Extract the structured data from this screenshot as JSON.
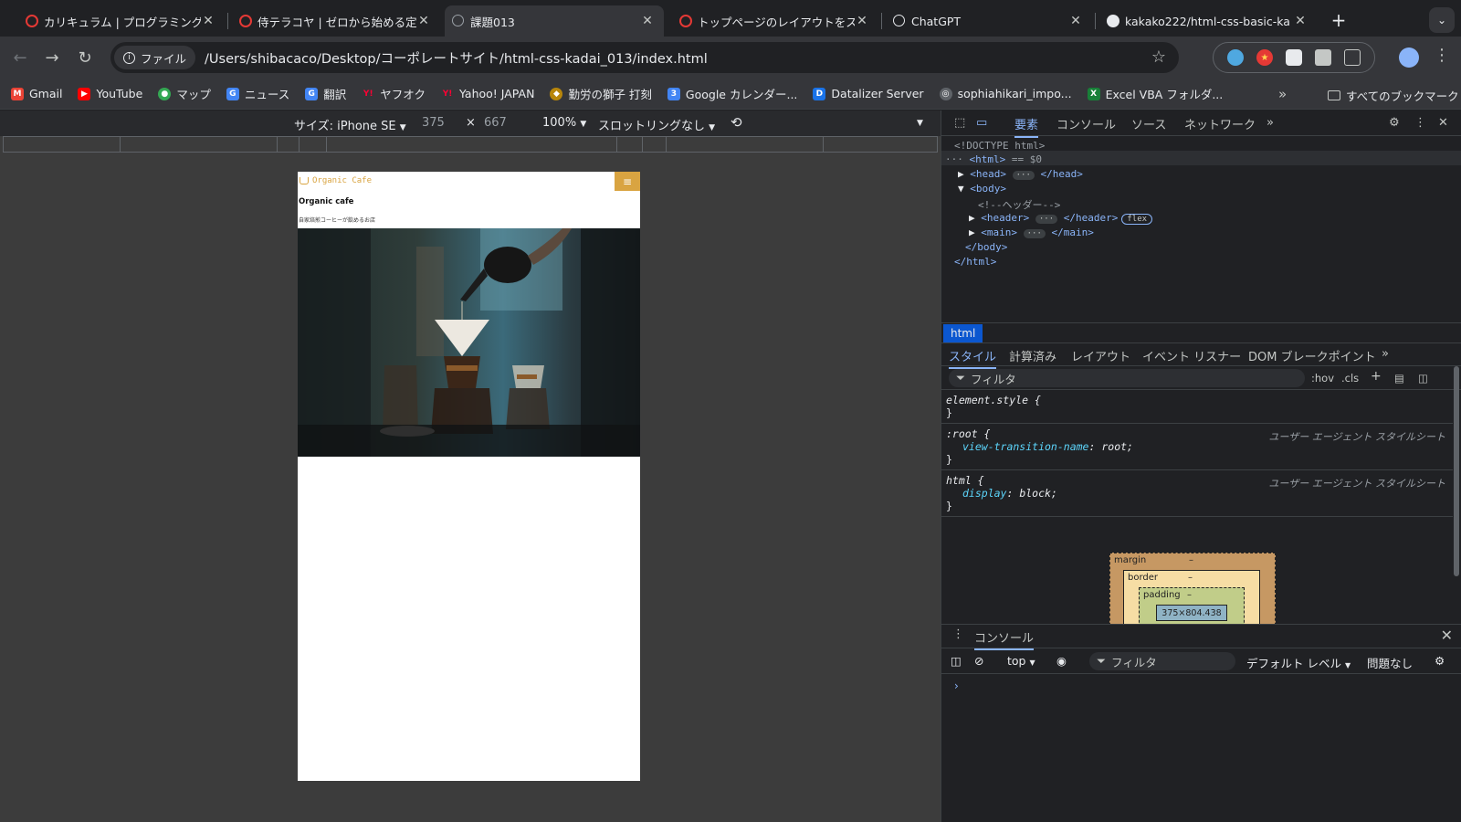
{
  "tabs": [
    {
      "title": "カリキュラム | プログラミング学",
      "icon": "samurai-logo-icon",
      "color": "#e53935",
      "active": false
    },
    {
      "title": "侍テラコヤ | ゼロから始める定額",
      "icon": "samurai-logo-icon",
      "color": "#e53935",
      "active": false
    },
    {
      "title": "課題013",
      "icon": "globe-icon",
      "color": "#9aa0a6",
      "active": true
    },
    {
      "title": "トップページのレイアウトをスマ",
      "icon": "samurai-logo-icon",
      "color": "#e53935",
      "active": false
    },
    {
      "title": "ChatGPT",
      "icon": "chatgpt-icon",
      "color": "#e8eaed",
      "active": false
    },
    {
      "title": "kakako222/html-css-basic-ka",
      "icon": "github-icon",
      "color": "#e8eaed",
      "active": false
    }
  ],
  "address": {
    "info_label": "ファイル",
    "url": "/Users/shibacaco/Desktop/コーポレートサイト/html-css-kadai_013/index.html"
  },
  "bookmarks": [
    {
      "label": "Gmail",
      "color": "#ea4335",
      "glyph": "M"
    },
    {
      "label": "YouTube",
      "color": "#ff0000",
      "glyph": "▶"
    },
    {
      "label": "マップ",
      "color": "#34a853",
      "glyph": "●"
    },
    {
      "label": "ニュース",
      "color": "#4285f4",
      "glyph": "G"
    },
    {
      "label": "翻訳",
      "color": "#4285f4",
      "glyph": "G"
    },
    {
      "label": "ヤフオク",
      "color": "#ff0033",
      "glyph": "Y"
    },
    {
      "label": "Yahoo! JAPAN",
      "color": "#ff0033",
      "glyph": "Y"
    },
    {
      "label": "勤労の獅子 打刻",
      "color": "#b8860b",
      "glyph": "◆"
    },
    {
      "label": "Google カレンダー...",
      "color": "#4285f4",
      "glyph": "3"
    },
    {
      "label": "Datalizer Server",
      "color": "#1a73e8",
      "glyph": "D"
    },
    {
      "label": "sophiahikari_impo...",
      "color": "#9aa0a6",
      "glyph": "◎"
    },
    {
      "label": "Excel VBA フォルダ...",
      "color": "#188038",
      "glyph": "X"
    }
  ],
  "bookmarks_all": "すべてのブックマーク",
  "device_bar": {
    "size_label": "サイズ: iPhone SE",
    "width": "375",
    "times": "×",
    "height": "667",
    "zoom": "100%",
    "throttle": "スロットリングなし"
  },
  "site": {
    "logo": "Organic Cafe",
    "title": "Organic cafe",
    "subtitle": "自家焙煎コーヒーが飲めるお店",
    "menu_glyph": "≡",
    "accent": "#d9a441"
  },
  "devtools": {
    "tabs": [
      "要素",
      "コンソール",
      "ソース",
      "ネットワーク"
    ],
    "dom": {
      "doctype": "<!DOCTYPE html>",
      "html_open": "<html>",
      "html_sel": " == $0",
      "head": "<head>",
      "head_close": "</head>",
      "body_open": "<body>",
      "comment": "<!--ヘッダー-->",
      "header": "<header>",
      "header_close": "</header>",
      "flex": "flex",
      "main": "<main>",
      "main_close": "</main>",
      "body_close": "</body>",
      "html_close": "</html>",
      "ellipsis": "···"
    },
    "breadcrumb": "html",
    "sub_tabs": [
      "スタイル",
      "計算済み",
      "レイアウト",
      "イベント リスナー",
      "DOM ブレークポイント"
    ],
    "filter_placeholder": "フィルタ",
    "hov": ":hov",
    "cls": ".cls",
    "rules": [
      {
        "selector": "element.style {",
        "close": "}",
        "ua": "",
        "props": []
      },
      {
        "selector": ":root {",
        "close": "}",
        "ua": "ユーザー エージェント スタイルシート",
        "props": [
          {
            "name": "view-transition-name",
            "value": "root;"
          }
        ]
      },
      {
        "selector": "html {",
        "close": "}",
        "ua": "ユーザー エージェント スタイルシート",
        "props": [
          {
            "name": "display",
            "value": "block;"
          }
        ]
      }
    ],
    "box_model": {
      "margin": "margin",
      "border": "border",
      "padding": "padding",
      "dash": "–",
      "content": "375×804.438"
    },
    "console": {
      "title": "コンソール",
      "context": "top",
      "filter": "フィルタ",
      "level": "デフォルト レベル",
      "issues": "問題なし",
      "prompt": "›"
    }
  }
}
